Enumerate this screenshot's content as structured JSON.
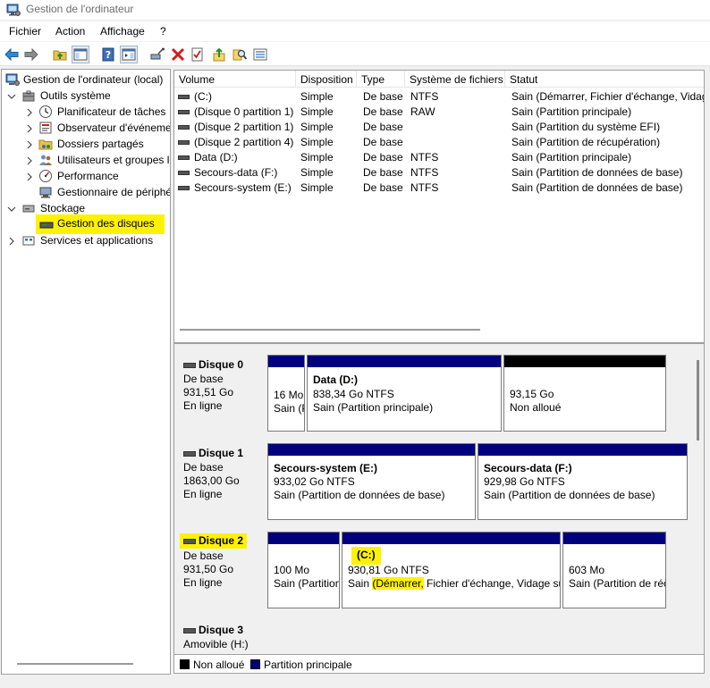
{
  "window": {
    "title": "Gestion de l'ordinateur"
  },
  "menu": [
    "Fichier",
    "Action",
    "Affichage",
    "?"
  ],
  "tree": {
    "root": "Gestion de l'ordinateur (local)",
    "system_tools": "Outils système",
    "task_scheduler": "Planificateur de tâches",
    "event_viewer": "Observateur d'événements",
    "shared_folders": "Dossiers partagés",
    "local_users": "Utilisateurs et groupes locaux",
    "performance": "Performance",
    "device_manager": "Gestionnaire de périphériques",
    "storage": "Stockage",
    "disk_management": "Gestion des disques",
    "services_apps": "Services et applications"
  },
  "volume_list": {
    "columns": [
      "Volume",
      "Disposition",
      "Type",
      "Système de fichiers",
      "Statut"
    ],
    "rows": [
      {
        "volume": "(C:)",
        "layout": "Simple",
        "type": "De base",
        "fs": "NTFS",
        "status": "Sain (Démarrer, Fichier d'échange, Vidage sur incident, Partition principale)"
      },
      {
        "volume": "(Disque 0 partition 1)",
        "layout": "Simple",
        "type": "De base",
        "fs": "RAW",
        "status": "Sain (Partition principale)"
      },
      {
        "volume": "(Disque 2 partition 1)",
        "layout": "Simple",
        "type": "De base",
        "fs": "",
        "status": "Sain (Partition du système EFI)"
      },
      {
        "volume": "(Disque 2 partition 4)",
        "layout": "Simple",
        "type": "De base",
        "fs": "",
        "status": "Sain (Partition de récupération)"
      },
      {
        "volume": "Data (D:)",
        "layout": "Simple",
        "type": "De base",
        "fs": "NTFS",
        "status": "Sain (Partition principale)"
      },
      {
        "volume": "Secours-data (F:)",
        "layout": "Simple",
        "type": "De base",
        "fs": "NTFS",
        "status": "Sain (Partition de données de base)"
      },
      {
        "volume": "Secours-system (E:)",
        "layout": "Simple",
        "type": "De base",
        "fs": "NTFS",
        "status": "Sain (Partition de données de base)"
      }
    ]
  },
  "disks": [
    {
      "name": "Disque 0",
      "type": "De base",
      "size": "931,51 Go",
      "status": "En ligne",
      "partitions": [
        {
          "title": "",
          "size": "16 Mo",
          "status": "Sain (Partition principale)"
        },
        {
          "title": "Data  (D:)",
          "size": "838,34 Go NTFS",
          "status": "Sain (Partition principale)"
        },
        {
          "title": "",
          "size": "93,15 Go",
          "status": "Non alloué"
        }
      ]
    },
    {
      "name": "Disque 1",
      "type": "De base",
      "size": "1863,00 Go",
      "status": "En ligne",
      "partitions": [
        {
          "title": "Secours-system  (E:)",
          "size": "933,02 Go NTFS",
          "status": "Sain (Partition de données de base)"
        },
        {
          "title": "Secours-data  (F:)",
          "size": "929,98 Go NTFS",
          "status": "Sain (Partition de données de base)"
        }
      ]
    },
    {
      "name": "Disque 2",
      "type": "De base",
      "size": "931,50 Go",
      "status": "En ligne",
      "partitions": [
        {
          "title": "",
          "size": "100 Mo",
          "status": "Sain (Partition du système EFI)"
        },
        {
          "title": "(C:)",
          "size": "930,81 Go NTFS",
          "status_hl": "(Démarrer,",
          "status_rest": " Fichier d'échange, Vidage sur incident, Partition principale)",
          "status_pre": "Sain "
        },
        {
          "title": "",
          "size": "603 Mo",
          "status": "Sain (Partition de récupération)"
        }
      ]
    },
    {
      "name": "Disque 3",
      "type": "Amovible (H:)"
    }
  ],
  "legend": {
    "unallocated": "Non alloué",
    "primary": "Partition principale"
  },
  "colors": {
    "primary": "#00007f",
    "unallocated": "#000000",
    "highlight": "#fff200",
    "selection": "#cce8ff"
  }
}
